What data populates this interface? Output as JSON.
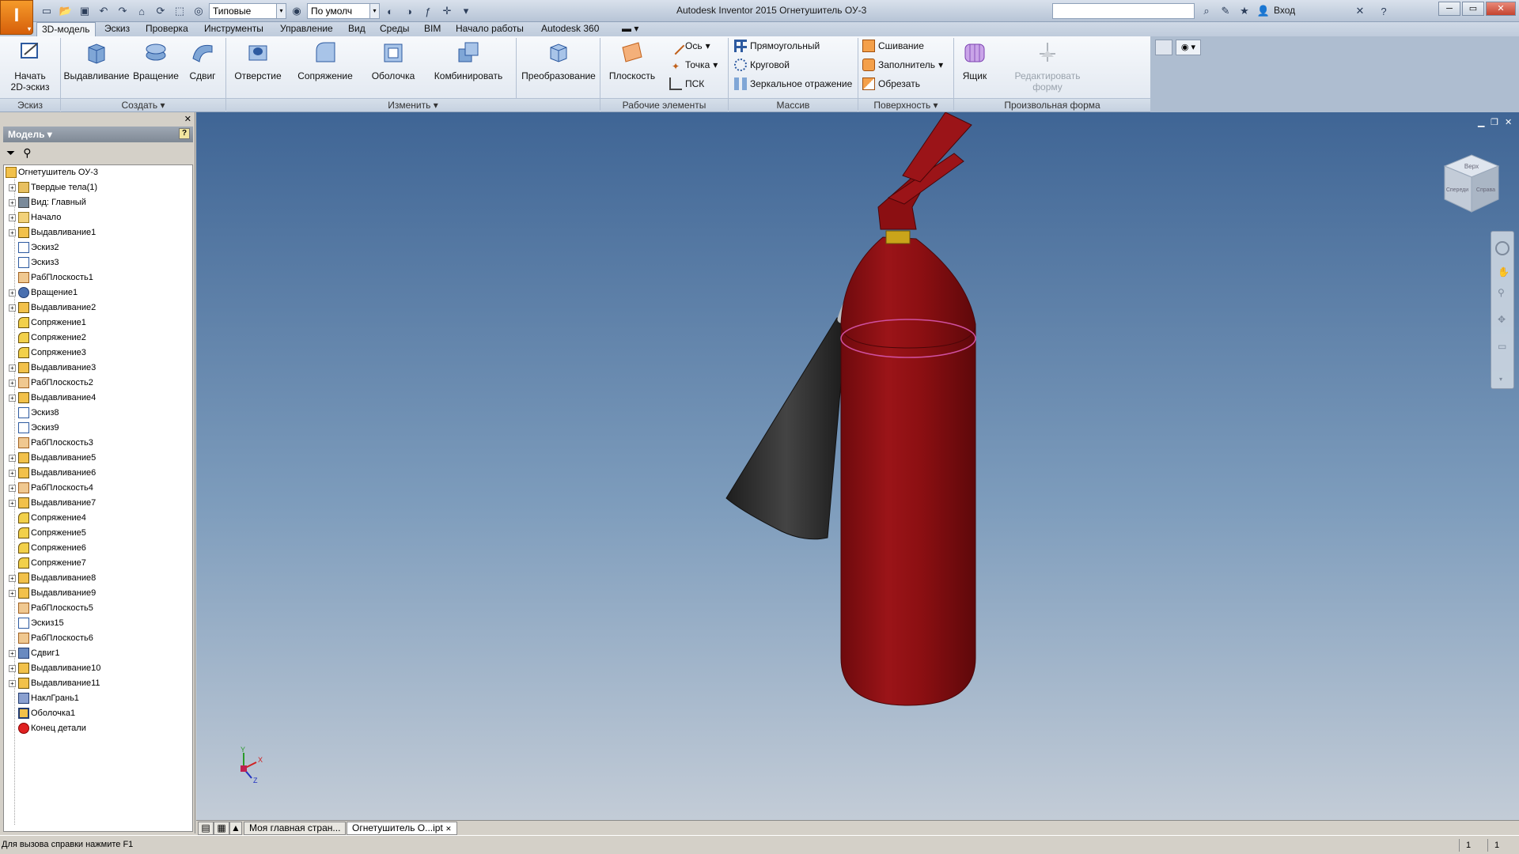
{
  "titlebar": {
    "app_title": "Autodesk Inventor 2015   Огнетушитель ОУ-3",
    "material_select": "Типовые",
    "appearance_select": "По умолч",
    "sign_in": "Вход"
  },
  "tabs": [
    "3D-модель",
    "Эскиз",
    "Проверка",
    "Инструменты",
    "Управление",
    "Вид",
    "Среды",
    "BIM",
    "Начало работы",
    "Autodesk 360"
  ],
  "ribbon": {
    "sketch_panel": {
      "label": "Эскиз",
      "start_sketch": "Начать\n2D-эскиз"
    },
    "create_panel": {
      "label": "Создать",
      "extrude": "Выдавливание",
      "revolve": "Вращение",
      "sweep": "Сдвиг"
    },
    "modify_panel": {
      "label": "Изменить",
      "hole": "Отверстие",
      "fillet": "Сопряжение",
      "shell": "Оболочка",
      "combine": "Комбинировать",
      "transform": "Преобразование"
    },
    "work_panel": {
      "label": "Рабочие элементы",
      "plane": "Плоскость",
      "axis": "Ось",
      "point": "Точка",
      "ucs": "ПСК"
    },
    "pattern_panel": {
      "label": "Массив",
      "rectangular": "Прямоугольный",
      "circular": "Круговой",
      "mirror": "Зеркальное отражение"
    },
    "surface_panel": {
      "label": "Поверхность",
      "stitch": "Сшивание",
      "patch": "Заполнитель",
      "trim": "Обрезать"
    },
    "freeform_panel": {
      "label": "Произвольная форма",
      "box": "Ящик",
      "edit_form": "Редактировать\nформу"
    }
  },
  "browser": {
    "header": "Модель",
    "root": "Огнетушитель ОУ-3",
    "items": [
      {
        "label": "Твердые тела(1)",
        "exp": true,
        "icon": "solids"
      },
      {
        "label": "Вид: Главный",
        "exp": true,
        "icon": "view"
      },
      {
        "label": "Начало",
        "exp": true,
        "icon": "folder"
      },
      {
        "label": "Выдавливание1",
        "exp": true,
        "icon": "extrude"
      },
      {
        "label": "Эскиз2",
        "exp": false,
        "icon": "sketch"
      },
      {
        "label": "Эскиз3",
        "exp": false,
        "icon": "sketch"
      },
      {
        "label": "РабПлоскость1",
        "exp": false,
        "icon": "plane"
      },
      {
        "label": "Вращение1",
        "exp": true,
        "icon": "revolve"
      },
      {
        "label": "Выдавливание2",
        "exp": true,
        "icon": "extrude"
      },
      {
        "label": "Сопряжение1",
        "exp": false,
        "icon": "fillet"
      },
      {
        "label": "Сопряжение2",
        "exp": false,
        "icon": "fillet"
      },
      {
        "label": "Сопряжение3",
        "exp": false,
        "icon": "fillet"
      },
      {
        "label": "Выдавливание3",
        "exp": true,
        "icon": "extrude"
      },
      {
        "label": "РабПлоскость2",
        "exp": true,
        "icon": "plane"
      },
      {
        "label": "Выдавливание4",
        "exp": true,
        "icon": "extrude"
      },
      {
        "label": "Эскиз8",
        "exp": false,
        "icon": "sketch"
      },
      {
        "label": "Эскиз9",
        "exp": false,
        "icon": "sketch"
      },
      {
        "label": "РабПлоскость3",
        "exp": false,
        "icon": "plane"
      },
      {
        "label": "Выдавливание5",
        "exp": true,
        "icon": "extrude"
      },
      {
        "label": "Выдавливание6",
        "exp": true,
        "icon": "extrude"
      },
      {
        "label": "РабПлоскость4",
        "exp": true,
        "icon": "plane"
      },
      {
        "label": "Выдавливание7",
        "exp": true,
        "icon": "extrude"
      },
      {
        "label": "Сопряжение4",
        "exp": false,
        "icon": "fillet"
      },
      {
        "label": "Сопряжение5",
        "exp": false,
        "icon": "fillet"
      },
      {
        "label": "Сопряжение6",
        "exp": false,
        "icon": "fillet"
      },
      {
        "label": "Сопряжение7",
        "exp": false,
        "icon": "fillet"
      },
      {
        "label": "Выдавливание8",
        "exp": true,
        "icon": "extrude"
      },
      {
        "label": "Выдавливание9",
        "exp": true,
        "icon": "extrude"
      },
      {
        "label": "РабПлоскость5",
        "exp": false,
        "icon": "plane"
      },
      {
        "label": "Эскиз15",
        "exp": false,
        "icon": "sketch"
      },
      {
        "label": "РабПлоскость6",
        "exp": false,
        "icon": "plane"
      },
      {
        "label": "Сдвиг1",
        "exp": true,
        "icon": "sweep"
      },
      {
        "label": "Выдавливание10",
        "exp": true,
        "icon": "extrude"
      },
      {
        "label": "Выдавливание11",
        "exp": true,
        "icon": "extrude"
      },
      {
        "label": "НаклГрань1",
        "exp": false,
        "icon": "draft"
      },
      {
        "label": "Оболочка1",
        "exp": false,
        "icon": "shell"
      },
      {
        "label": "Конец детали",
        "exp": false,
        "icon": "eop"
      }
    ]
  },
  "viewport": {
    "triad": {
      "x": "X",
      "y": "Y",
      "z": "Z"
    },
    "viewcube": {
      "top": "Верх",
      "front": "Спереди",
      "right": "Справа"
    }
  },
  "doctabs": [
    "Моя главная стран...",
    "Огнетушитель О...ipt"
  ],
  "status": {
    "help_text": "Для вызова справки нажмите F1",
    "count1": "1",
    "count2": "1"
  },
  "colors": {
    "body_red": "#8b0f12",
    "horn_black": "#2a2a2a",
    "viewport_top": "#3f6595",
    "viewport_bottom": "#c3ccd7"
  }
}
